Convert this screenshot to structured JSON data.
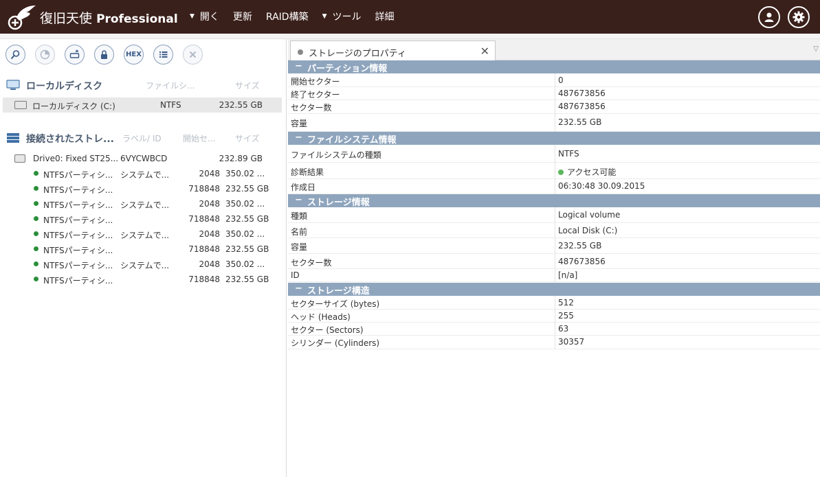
{
  "app": {
    "title_main": "復旧天使",
    "title_edition": "Professional",
    "menu": [
      {
        "label": "開く",
        "has_arrow": true
      },
      {
        "label": "更新",
        "has_arrow": false
      },
      {
        "label": "RAID構築",
        "has_arrow": false
      },
      {
        "label": "ツール",
        "has_arrow": true
      },
      {
        "label": "詳細",
        "has_arrow": false
      }
    ],
    "colors": {
      "titlebar": "#3a201b",
      "group_header": "#8fa5bd",
      "status_green": "#2a8f3a"
    }
  },
  "toolbar": {
    "icons": [
      "search-icon",
      "scan-icon",
      "recover-icon",
      "lock-icon",
      "hex-icon",
      "list-icon",
      "close-icon"
    ],
    "hex_label": "HEX"
  },
  "local_disks": {
    "title": "ローカルディスク",
    "col_fs": "ファイルシ...",
    "col_size": "サイズ",
    "items": [
      {
        "name": "ローカルディスク (C:)",
        "fs": "NTFS",
        "size": "232.55 GB"
      }
    ]
  },
  "connected": {
    "title": "接続されたストレ...",
    "col_label": "ラベル/ ID",
    "col_start": "開始セ...",
    "col_size": "サイズ",
    "drive": {
      "name": "Drive0: Fixed ST25...",
      "id": "6VYCWBCD",
      "size": "232.89 GB"
    },
    "partitions": [
      {
        "name": "NTFSパーティシ...",
        "label": "システムで...",
        "start": "2048",
        "size": "350.02 ..."
      },
      {
        "name": "NTFSパーティシ...",
        "label": "",
        "start": "718848",
        "size": "232.55 GB"
      },
      {
        "name": "NTFSパーティシ...",
        "label": "システムで...",
        "start": "2048",
        "size": "350.02 ..."
      },
      {
        "name": "NTFSパーティシ...",
        "label": "",
        "start": "718848",
        "size": "232.55 GB"
      },
      {
        "name": "NTFSパーティシ...",
        "label": "システムで...",
        "start": "2048",
        "size": "350.02 ..."
      },
      {
        "name": "NTFSパーティシ...",
        "label": "",
        "start": "718848",
        "size": "232.55 GB"
      },
      {
        "name": "NTFSパーティシ...",
        "label": "システムで...",
        "start": "2048",
        "size": "350.02 ..."
      },
      {
        "name": "NTFSパーティシ...",
        "label": "",
        "start": "718848",
        "size": "232.55 GB"
      }
    ]
  },
  "tab": {
    "label": "ストレージのプロパティ"
  },
  "properties": {
    "partition": {
      "title": "パーティション情報",
      "rows": [
        {
          "key": "開始セクター",
          "value": "0"
        },
        {
          "key": "終了セクター",
          "value": "487673856"
        },
        {
          "key": "セクター数",
          "value": "487673856"
        },
        {
          "key": "容量",
          "value": "232.55 GB"
        }
      ]
    },
    "filesystem": {
      "title": "ファイルシステム情報",
      "rows": [
        {
          "key": "ファイルシステムの種類",
          "value": "NTFS"
        },
        {
          "key": "診断結果",
          "value": "アクセス可能"
        },
        {
          "key": "作成日",
          "value": "06:30:48 30.09.2015"
        }
      ]
    },
    "storage": {
      "title": "ストレージ情報",
      "rows": [
        {
          "key": "種類",
          "value": "Logical volume"
        },
        {
          "key": "名前",
          "value": "Local Disk (C:)"
        },
        {
          "key": "容量",
          "value": "232.55 GB"
        },
        {
          "key": "セクター数",
          "value": "487673856"
        },
        {
          "key": "ID",
          "value": "[n/a]"
        }
      ]
    },
    "structure": {
      "title": "ストレージ構造",
      "rows": [
        {
          "key": "セクターサイズ (bytes)",
          "value": "512"
        },
        {
          "key": "ヘッド (Heads)",
          "value": "255"
        },
        {
          "key": "セクター (Sectors)",
          "value": "63"
        },
        {
          "key": "シリンダー (Cylinders)",
          "value": "30357"
        }
      ]
    }
  }
}
